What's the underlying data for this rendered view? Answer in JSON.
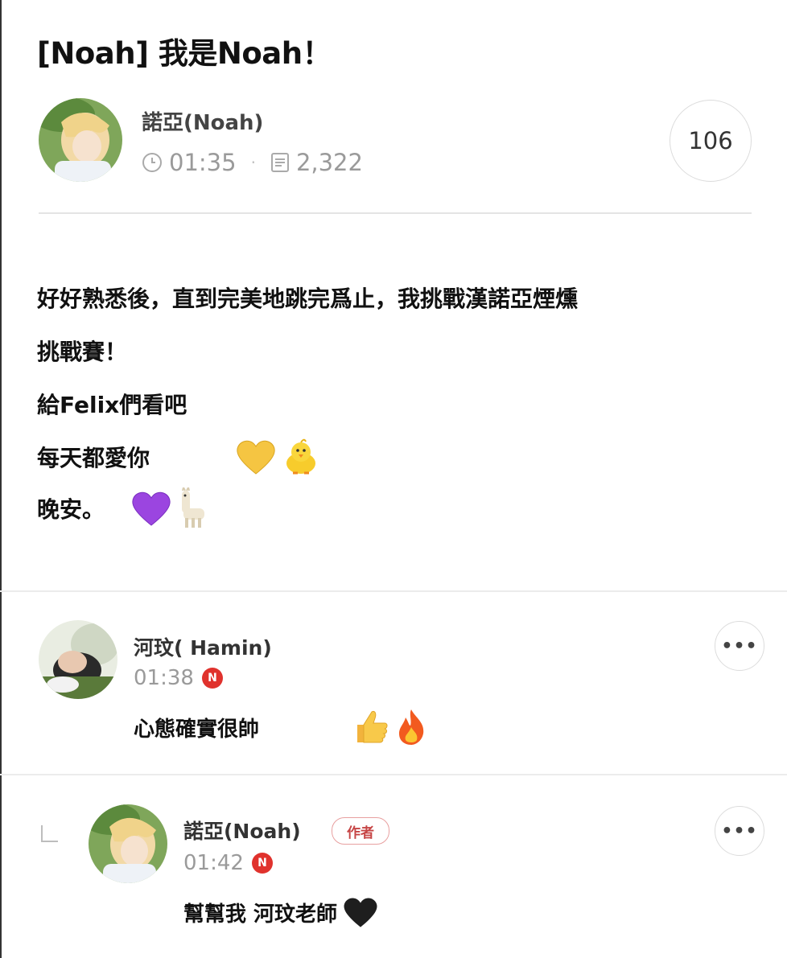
{
  "post": {
    "title": "[Noah] 我是Noah！",
    "author": "諾亞(Noah)",
    "time": "01:35",
    "views": "2,322",
    "comment_count": "106"
  },
  "body": {
    "line1": "好好熟悉後，直到完美地跳完爲止，我挑戰漢諾亞煙燻",
    "line2": "挑戰賽！",
    "line3": "給Felix們看吧",
    "line4": "每天都愛你",
    "line5": "晚安。",
    "emojis": [
      "yellow-heart",
      "chick",
      "purple-heart",
      "llama"
    ]
  },
  "comments": [
    {
      "author": "河玟( Hamin)",
      "time": "01:38",
      "badge": "N",
      "text": "心態確實很帥",
      "emojis": [
        "thumbs-up",
        "fire"
      ]
    }
  ],
  "reply": {
    "author": "諾亞(Noah)",
    "tag": "作者",
    "time": "01:42",
    "badge": "N",
    "text": "幫幫我 河玟老師"
  },
  "ui": {
    "more_label": "•••",
    "icons": [
      "clock-icon",
      "document-icon",
      "reply-arrow-icon",
      "more-icon"
    ]
  },
  "colors": {
    "badge_red": "#e0322d",
    "author_tag": "#c64545"
  }
}
